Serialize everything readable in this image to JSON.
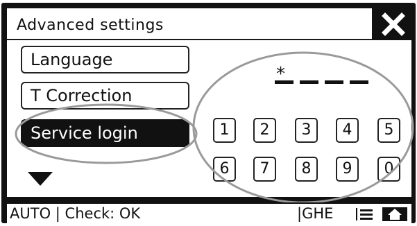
{
  "window": {
    "title": "Advanced settings"
  },
  "menu": {
    "items": [
      {
        "label": "Language"
      },
      {
        "label": "T Correction"
      },
      {
        "label": "Service login",
        "selected": true
      }
    ]
  },
  "pin": {
    "entered_mask": "*",
    "slots": 4
  },
  "keypad": {
    "row1": [
      "1",
      "2",
      "3",
      "4",
      "5"
    ],
    "row2": [
      "6",
      "7",
      "8",
      "9",
      "0"
    ]
  },
  "status_bar": {
    "mode": "AUTO",
    "check": "Check: OK",
    "separator": "|",
    "code": "GHE"
  },
  "icons": [
    "close-icon",
    "chevron-down-icon",
    "list-icon",
    "home-icon"
  ],
  "colors": {
    "foreground": "#111111",
    "background": "#ffffff",
    "ellipse": "#9a9a9a"
  }
}
